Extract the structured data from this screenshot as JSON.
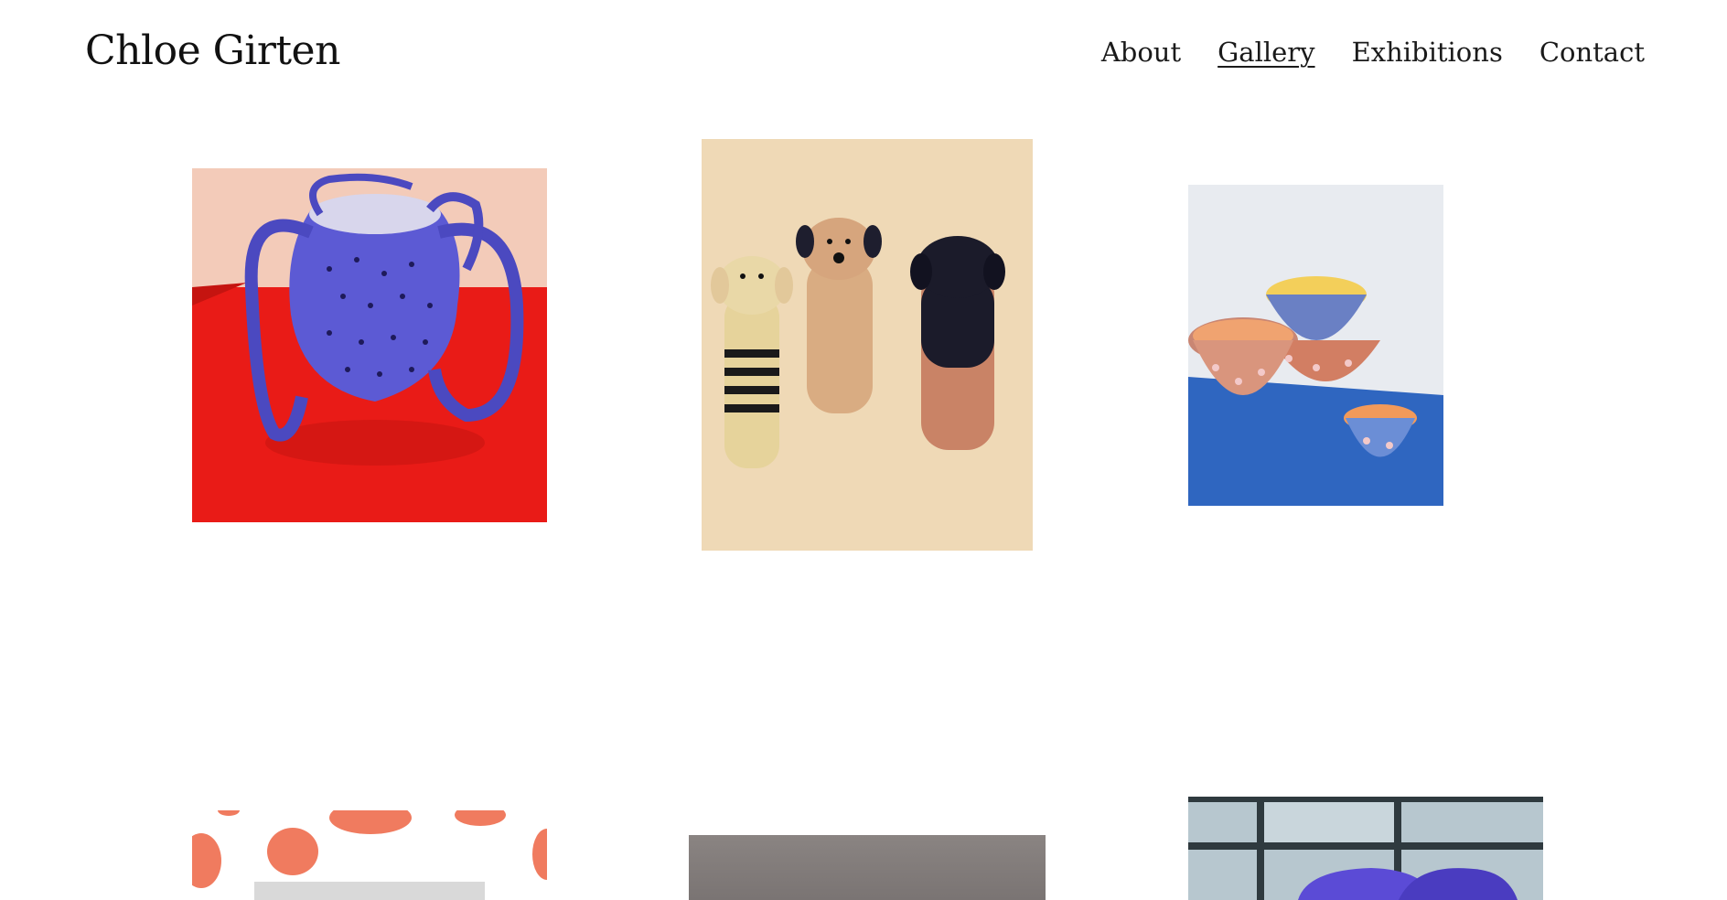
{
  "site": {
    "title": "Chloe Girten"
  },
  "nav": [
    {
      "label": "About",
      "active": false
    },
    {
      "label": "Gallery",
      "active": true
    },
    {
      "label": "Exhibitions",
      "active": false
    },
    {
      "label": "Contact",
      "active": false
    }
  ],
  "gallery": {
    "items": [
      {
        "subject": "blue ceramic vase with striped handles on red surface"
      },
      {
        "subject": "three ceramic dog figurines on cream background"
      },
      {
        "subject": "stacked dotted ceramic bowls on blue table"
      },
      {
        "subject": "orange polka dot pattern artwork"
      },
      {
        "subject": "grey photograph"
      },
      {
        "subject": "purple ceramic piece by window"
      }
    ]
  },
  "colors": {
    "vase_bg_top": "#f3cbb9",
    "vase_table": "#e91b17",
    "vase_blue": "#5c5ad4",
    "dogs_bg": "#efd9b6",
    "bowls_table": "#2f66c0",
    "dots_orange": "#f07b5f",
    "window_purple": "#5b4bd6"
  }
}
